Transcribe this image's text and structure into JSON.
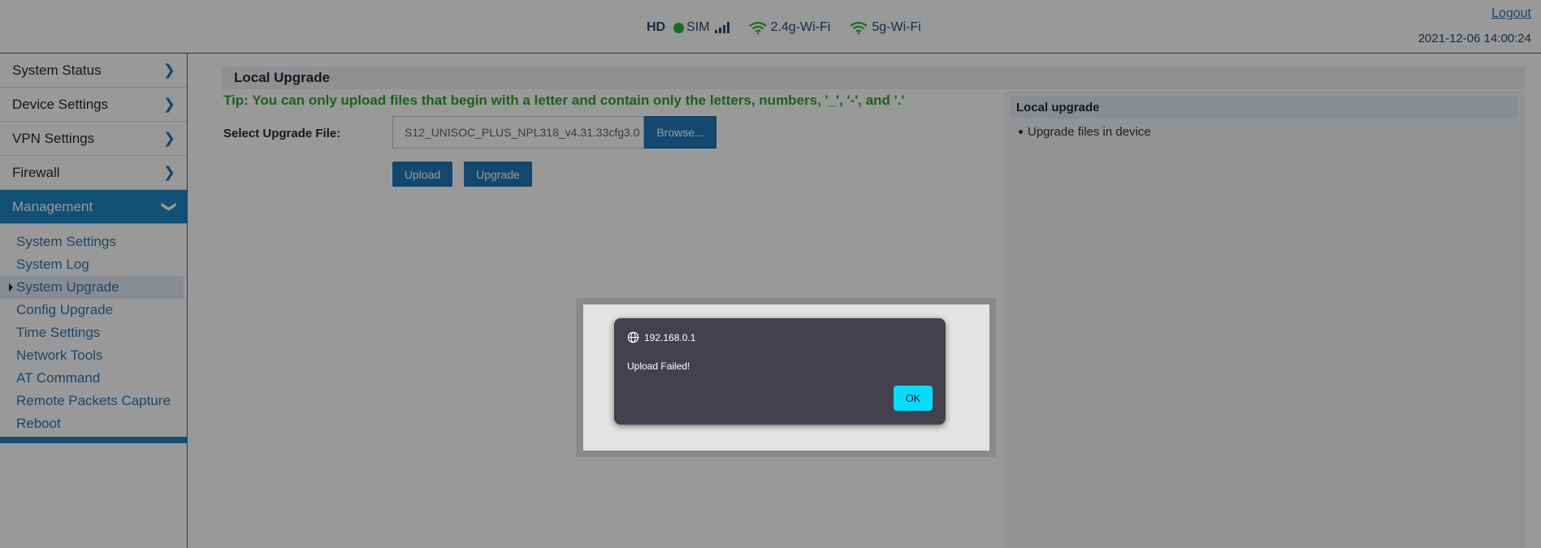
{
  "header": {
    "hd": "HD",
    "sim": "SIM",
    "wifi_24": "2.4g-Wi-Fi",
    "wifi_5": "5g-Wi-Fi",
    "logout": "Logout",
    "datetime": "2021-12-06 14:00:24",
    "status_color": "#2fb52f"
  },
  "sidebar": {
    "items": [
      {
        "label": "System Status"
      },
      {
        "label": "Device Settings"
      },
      {
        "label": "VPN Settings"
      },
      {
        "label": "Firewall"
      },
      {
        "label": "Management"
      }
    ],
    "submenu": [
      {
        "label": "System Settings"
      },
      {
        "label": "System Log"
      },
      {
        "label": "System Upgrade"
      },
      {
        "label": "Config Upgrade"
      },
      {
        "label": "Time Settings"
      },
      {
        "label": "Network Tools"
      },
      {
        "label": "AT Command"
      },
      {
        "label": "Remote Packets Capture"
      },
      {
        "label": "Reboot"
      }
    ],
    "accent_color": "#1f85c4"
  },
  "main": {
    "section_title": "Local Upgrade",
    "tip": "Tip: You can only upload files that begin with a letter and contain only the letters, numbers, '_', '-', and '.'",
    "file_label": "Select Upgrade File:",
    "file_value": "S12_UNISOC_PLUS_NPL318_v4.31.33cfg3.0",
    "browse": "Browse...",
    "upload": "Upload",
    "upgrade": "Upgrade",
    "help": {
      "title": "Local upgrade",
      "items": [
        "Upgrade files in device"
      ]
    }
  },
  "dialog": {
    "origin": "192.168.0.1",
    "message": "Upload Failed!",
    "ok": "OK",
    "ok_color": "#00ddff"
  }
}
